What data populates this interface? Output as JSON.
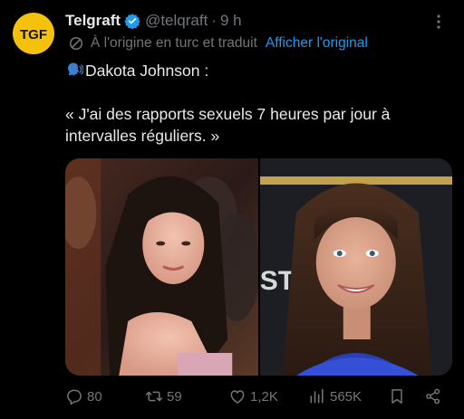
{
  "author": {
    "name": "Telgraft",
    "handle": "@telqraft",
    "separator": "·",
    "time": "9 h",
    "avatar_text": "TGF"
  },
  "translation": {
    "note": "À l'origine en turc et traduit",
    "show_original_label": "Afficher l'original"
  },
  "tweet": {
    "line1": "Dakota Johnson :",
    "quote": "« J'ai des rapports sexuels 7 heures par jour à intervalles réguliers. »"
  },
  "media": {
    "left_photo_sign_text": "",
    "right_photo_sign_text": "ST"
  },
  "actions": {
    "replies": "80",
    "retweets": "59",
    "likes": "1,2K",
    "views": "565K"
  },
  "colors": {
    "background": "#000000",
    "text": "#e7e9ea",
    "muted": "#71767b",
    "accent": "#1d9bf0",
    "avatar_bg": "#f4c20d"
  }
}
